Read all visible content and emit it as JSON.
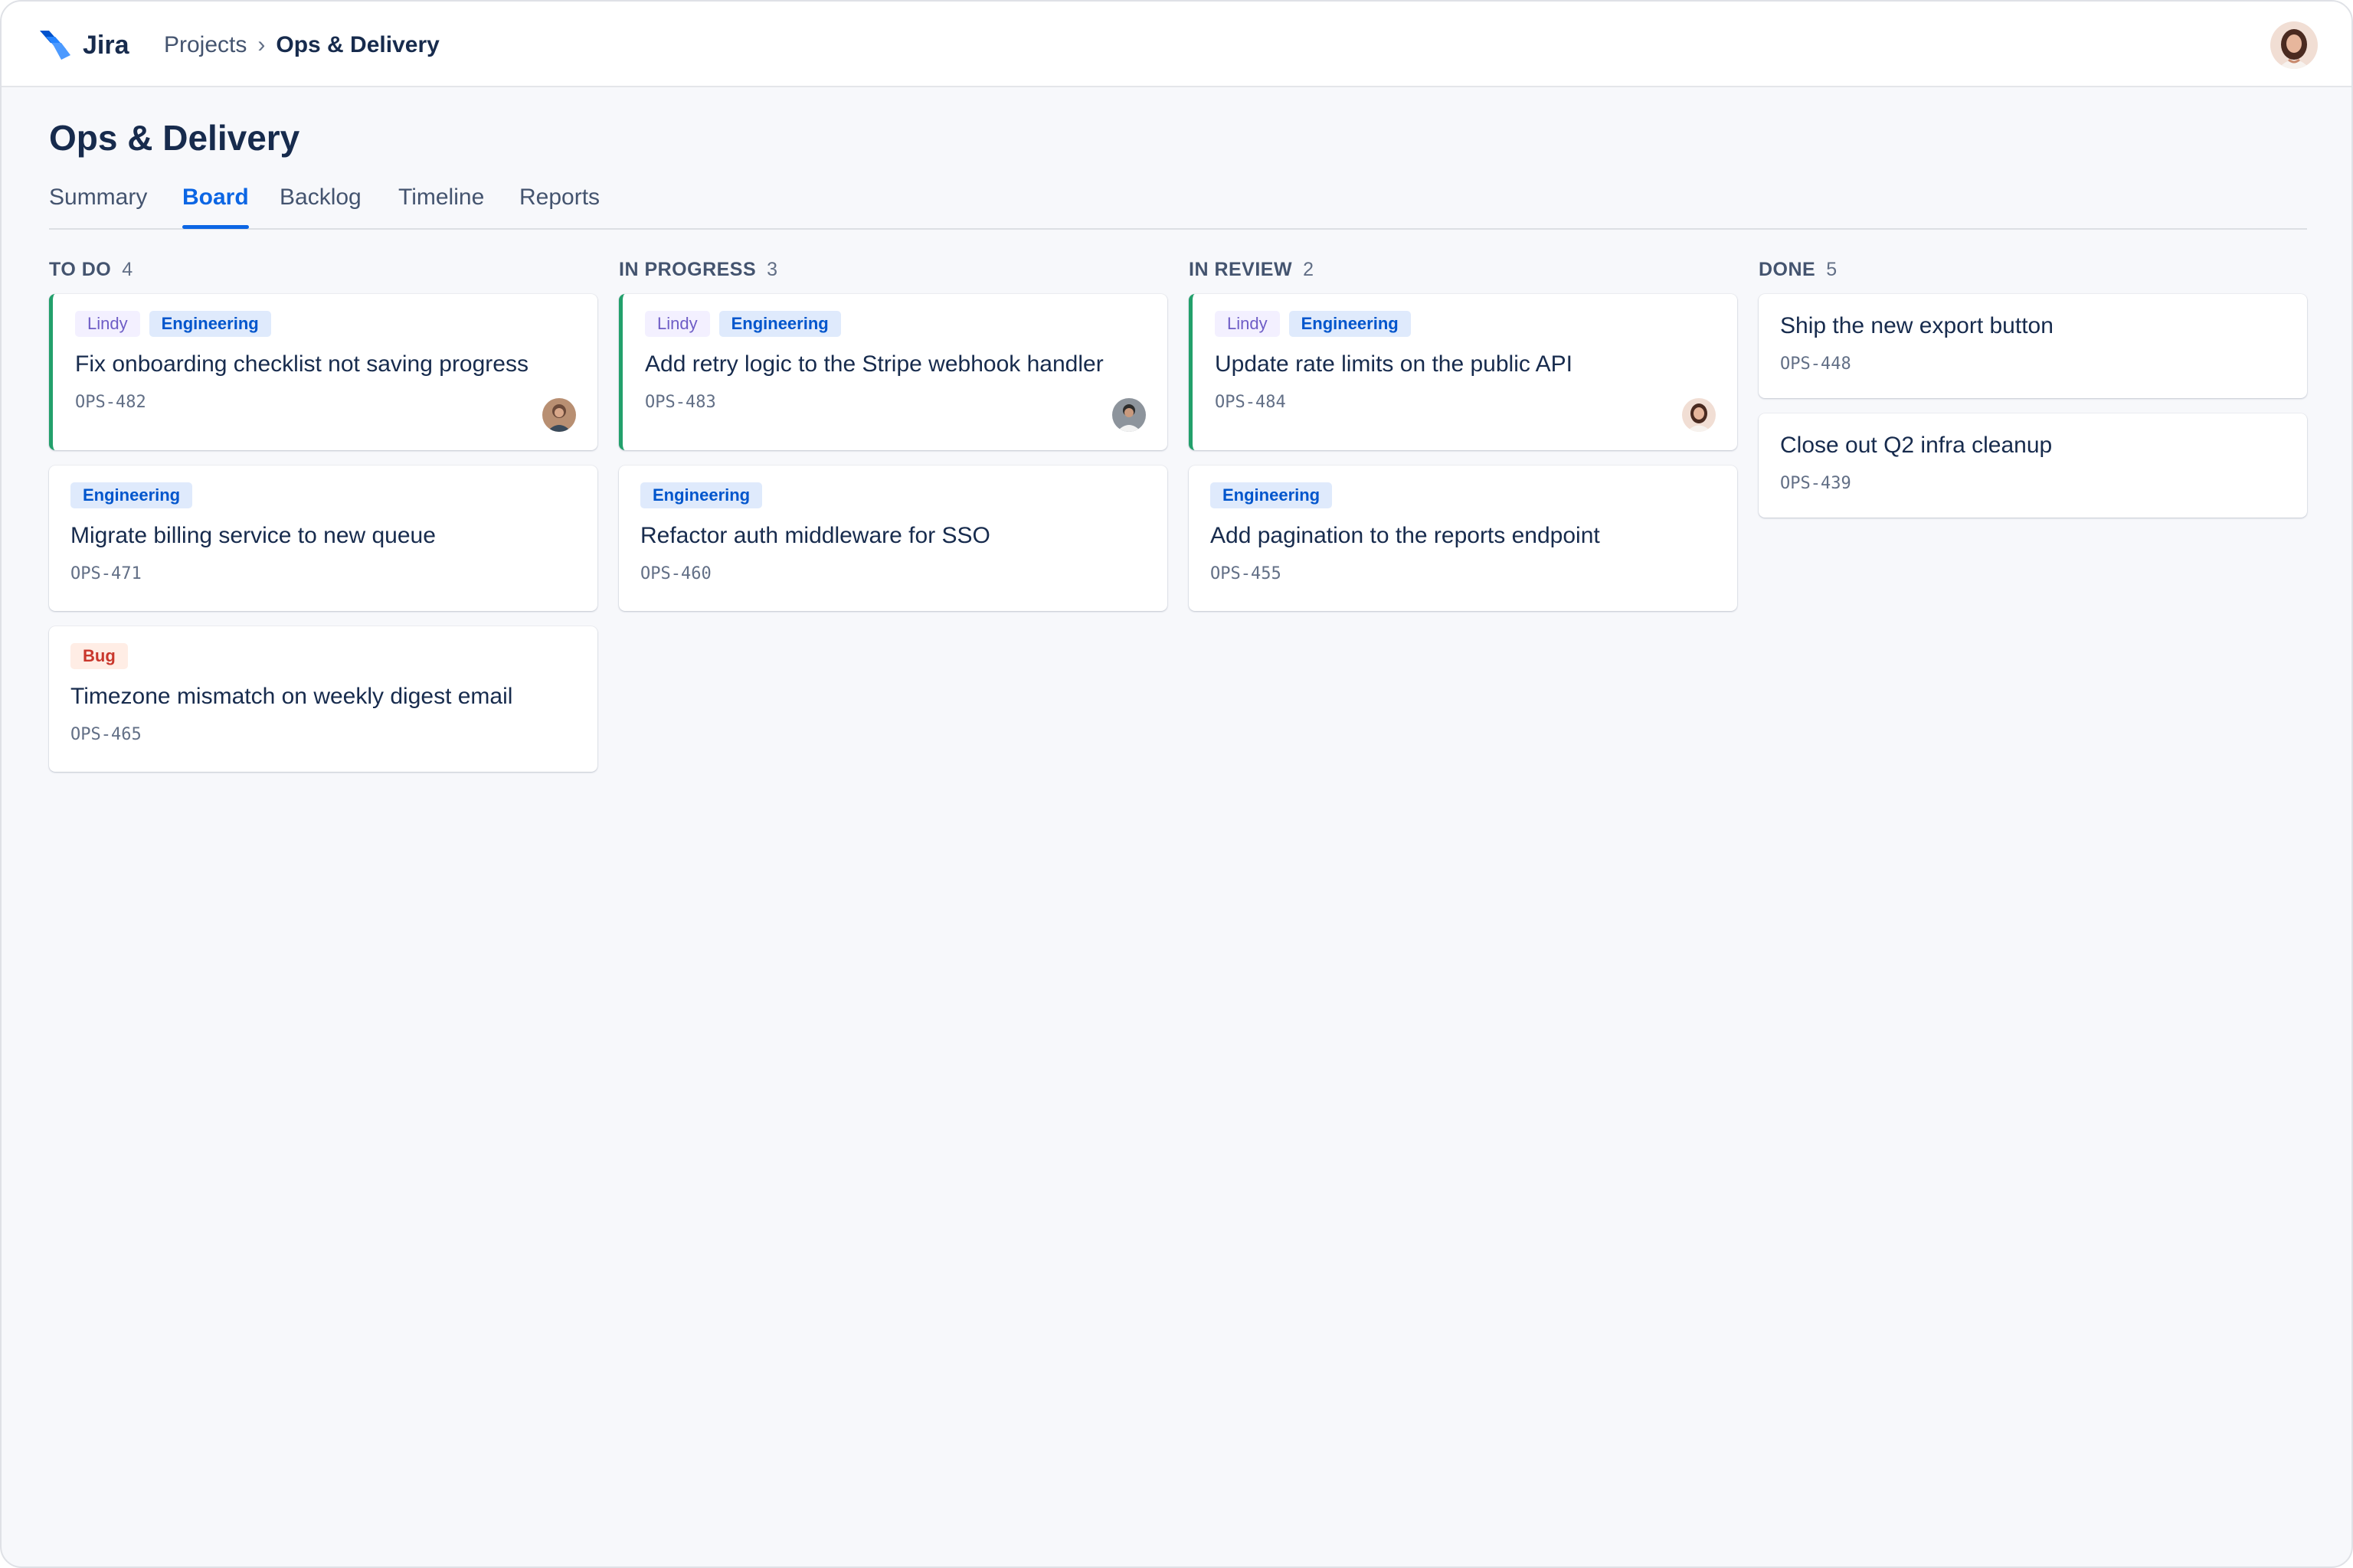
{
  "app": {
    "name": "Jira",
    "logo_icon": "jira-logo-icon",
    "brand_color": "#2684ff"
  },
  "breadcrumb": {
    "parent": "Projects",
    "separator": "›",
    "current": "Ops & Delivery"
  },
  "page": {
    "title": "Ops & Delivery"
  },
  "tabs": [
    {
      "label": "Summary",
      "active": false
    },
    {
      "label": "Board",
      "active": true
    },
    {
      "label": "Backlog",
      "active": false
    },
    {
      "label": "Timeline",
      "active": false
    },
    {
      "label": "Reports",
      "active": false
    }
  ],
  "colors": {
    "accent": "#0c66e4",
    "card_left_border": "#22a06b",
    "label_lindy_bg": "#f3f0ff",
    "label_engineering_bg": "#dfeafc",
    "label_bug_bg": "#ffede5"
  },
  "columns": [
    {
      "title": "TO DO",
      "count": "4",
      "cards": [
        {
          "labels": [
            "Lindy",
            "Engineering"
          ],
          "title": "Fix onboarding checklist not saving progress",
          "key": "OPS-482",
          "assignee_avatar": true
        },
        {
          "labels": [
            "Engineering"
          ],
          "title": "Migrate billing service to new queue",
          "key": "OPS-471"
        },
        {
          "labels": [
            "Bug"
          ],
          "title": "Timezone mismatch on weekly digest email",
          "key": "OPS-465"
        }
      ]
    },
    {
      "title": "IN PROGRESS",
      "count": "3",
      "cards": [
        {
          "labels": [
            "Lindy",
            "Engineering"
          ],
          "title": "Add retry logic to the Stripe webhook handler",
          "key": "OPS-483",
          "assignee_avatar": true
        },
        {
          "labels": [
            "Engineering"
          ],
          "title": "Refactor auth middleware for SSO",
          "key": "OPS-460"
        }
      ]
    },
    {
      "title": "IN REVIEW",
      "count": "2",
      "cards": [
        {
          "labels": [
            "Lindy",
            "Engineering"
          ],
          "title": "Update rate limits on the public API",
          "key": "OPS-484",
          "assignee_avatar": true
        },
        {
          "labels": [
            "Engineering"
          ],
          "title": "Add pagination to the reports endpoint",
          "key": "OPS-455"
        }
      ]
    },
    {
      "title": "DONE",
      "count": "5",
      "cards": [
        {
          "labels": [],
          "title": "Ship the new export button",
          "key": "OPS-448"
        },
        {
          "labels": [],
          "title": "Close out Q2 infra cleanup",
          "key": "OPS-439"
        }
      ]
    }
  ]
}
